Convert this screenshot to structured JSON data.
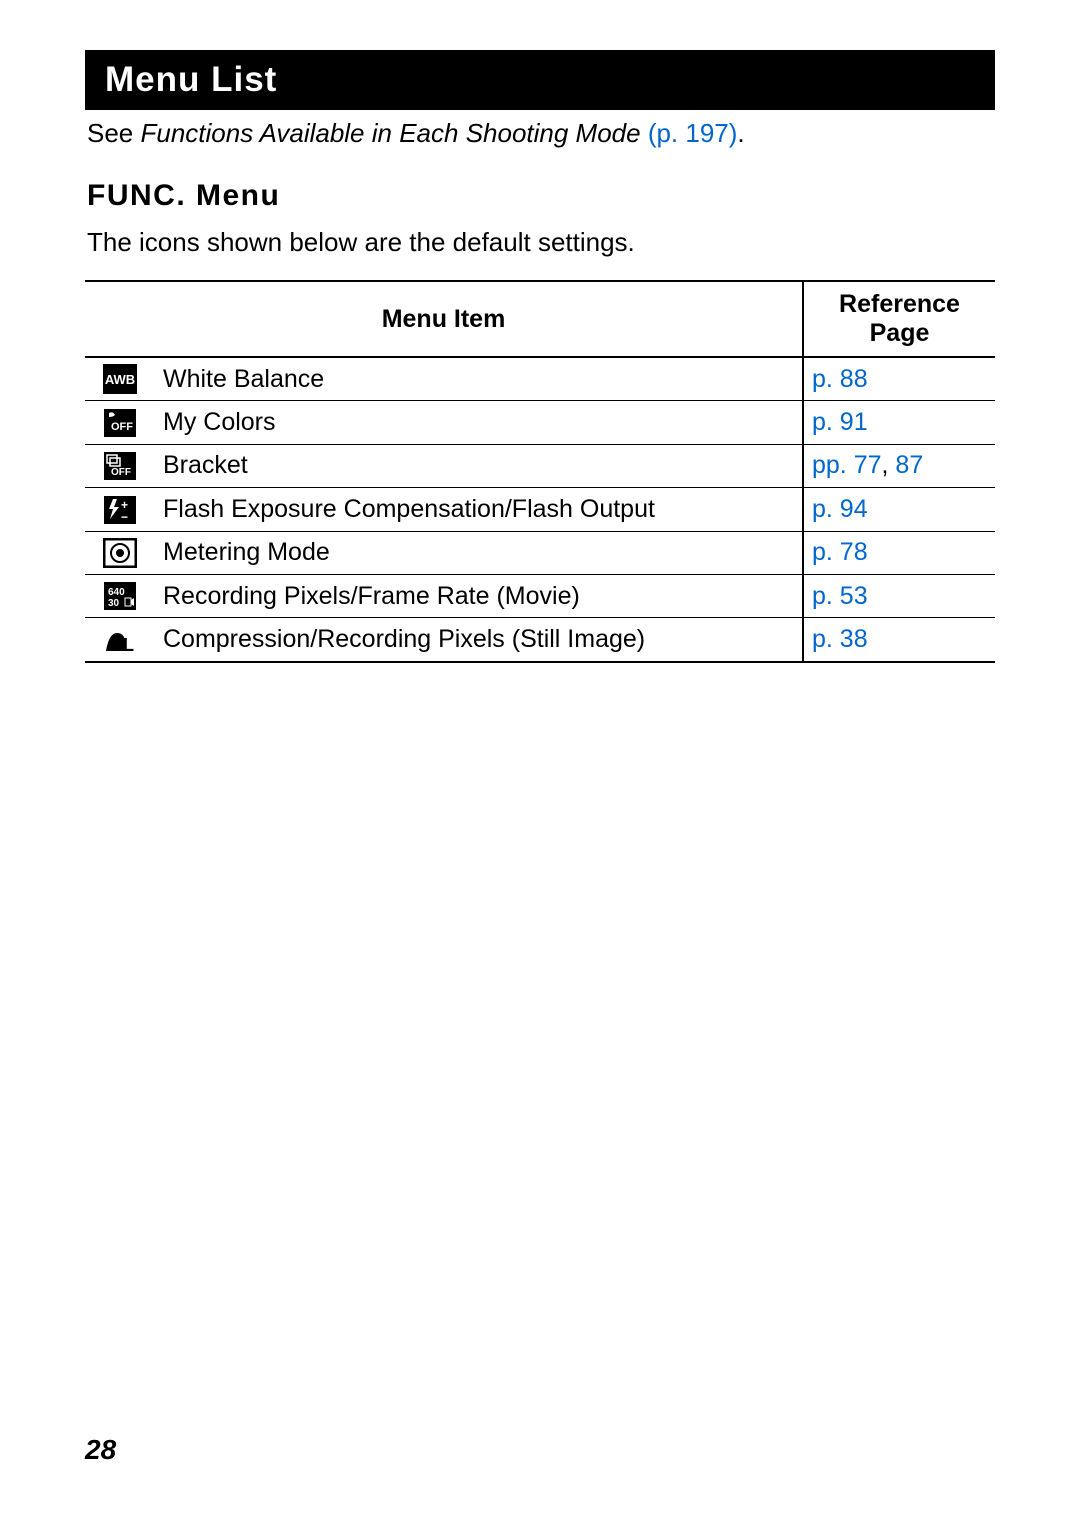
{
  "title": "Menu List",
  "see_prefix": "See ",
  "see_italic": "Functions Available in Each Shooting Mode",
  "see_link": " (p. 197)",
  "see_suffix": ".",
  "func_header": "FUNC. Menu",
  "default_line": "The icons shown below are the default settings.",
  "table": {
    "head_item": "Menu Item",
    "head_ref": "Reference Page",
    "rows": [
      {
        "icon_label": "AWB",
        "name": "White Balance",
        "ref_prefix": "p. ",
        "ref_a": "88",
        "ref_sep": "",
        "ref_b": ""
      },
      {
        "icon_label": "OFF",
        "name": "My Colors",
        "ref_prefix": "p. ",
        "ref_a": "91",
        "ref_sep": "",
        "ref_b": ""
      },
      {
        "icon_label": "OFF",
        "name": "Bracket",
        "ref_prefix": "pp. ",
        "ref_a": "77",
        "ref_sep": ", ",
        "ref_b": "87"
      },
      {
        "icon_label": "",
        "name": "Flash Exposure Compensation/Flash Output",
        "ref_prefix": "p. ",
        "ref_a": "94",
        "ref_sep": "",
        "ref_b": ""
      },
      {
        "icon_label": "",
        "name": "Metering Mode",
        "ref_prefix": "p. ",
        "ref_a": "78",
        "ref_sep": "",
        "ref_b": ""
      },
      {
        "icon_label": "640\n30",
        "name": "Recording Pixels/Frame Rate (Movie)",
        "ref_prefix": "p. ",
        "ref_a": "53",
        "ref_sep": "",
        "ref_b": ""
      },
      {
        "icon_label": "L",
        "name": "Compression/Recording Pixels (Still Image)",
        "ref_prefix": "p. ",
        "ref_a": "38",
        "ref_sep": "",
        "ref_b": ""
      }
    ]
  },
  "page_number": "28"
}
